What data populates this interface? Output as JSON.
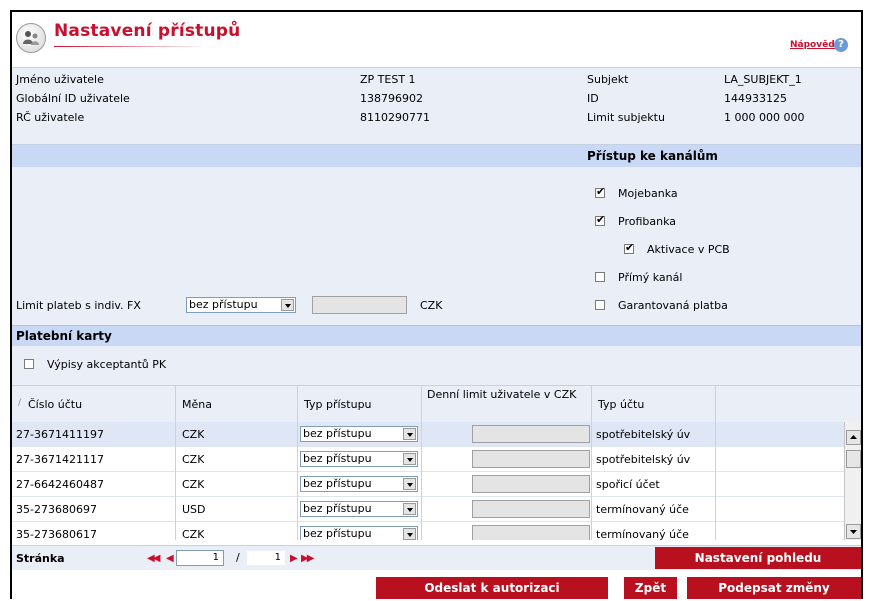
{
  "header": {
    "title": "Nastavení přístupů",
    "help_label": "Nápověda",
    "help_icon": "?"
  },
  "user_info": {
    "name_label": "Jméno uživatele",
    "name_value": "ZP TEST 1",
    "global_id_label": "Globální ID uživatele",
    "global_id_value": "138796902",
    "rc_label": "RČ uživatele",
    "rc_value": "8110290771",
    "subject_label": "Subjekt",
    "subject_value": "LA_SUBJEKT_1",
    "id_label": "ID",
    "id_value": "144933125",
    "limit_label": "Limit subjektu",
    "limit_value": "1 000 000 000"
  },
  "channels": {
    "title": "Přístup ke kanálům",
    "items": [
      {
        "label": "Mojebanka",
        "checked": true
      },
      {
        "label": "Profibanka",
        "checked": true
      },
      {
        "label": "Aktivace v PCB",
        "checked": true
      },
      {
        "label": "Přímý kanál",
        "checked": false
      },
      {
        "label": "Garantovaná platba",
        "checked": false
      }
    ],
    "fx_limit_label": "Limit plateb s indiv. FX",
    "fx_limit_select": "bez přístupu",
    "fx_currency": "CZK"
  },
  "cards": {
    "title": "Platební karty",
    "acceptant_label": "Výpisy akceptantů PK",
    "acceptant_checked": false
  },
  "table": {
    "sort_glyph": "/",
    "headers": {
      "account": "Číslo účtu",
      "currency": "Měna",
      "access": "Typ přístupu",
      "daily_limit": "Denní limit uživatele v CZK",
      "account_type": "Typ účtu"
    },
    "rows": [
      {
        "account": "27-3671411197",
        "currency": "CZK",
        "access": "bez přístupu",
        "account_type": "spotřebitelský úv"
      },
      {
        "account": "27-3671421117",
        "currency": "CZK",
        "access": "bez přístupu",
        "account_type": "spotřebitelský úv"
      },
      {
        "account": "27-6642460487",
        "currency": "CZK",
        "access": "bez přístupu",
        "account_type": "spořicí účet"
      },
      {
        "account": "35-273680697",
        "currency": "USD",
        "access": "bez přístupu",
        "account_type": "termínovaný úče"
      },
      {
        "account": "35-273680617",
        "currency": "CZK",
        "access": "bez přístupu",
        "account_type": "termínovaný úče"
      }
    ]
  },
  "pager": {
    "label": "Stránka",
    "current": "1",
    "separator": "/",
    "total": "1",
    "first_glyph": "◀◀",
    "prev_glyph": "◀",
    "next_glyph": "▶",
    "last_glyph": "▶▶"
  },
  "buttons": {
    "view_settings": "Nastavení pohledu",
    "send_auth": "Odeslat k autorizaci",
    "back": "Zpět",
    "sign": "Podepsat změny"
  },
  "colors": {
    "accent_red": "#c8102e",
    "button_red": "#b8101f",
    "panel_bg": "#e9eef7",
    "bar_blue": "#c9d8f5"
  }
}
